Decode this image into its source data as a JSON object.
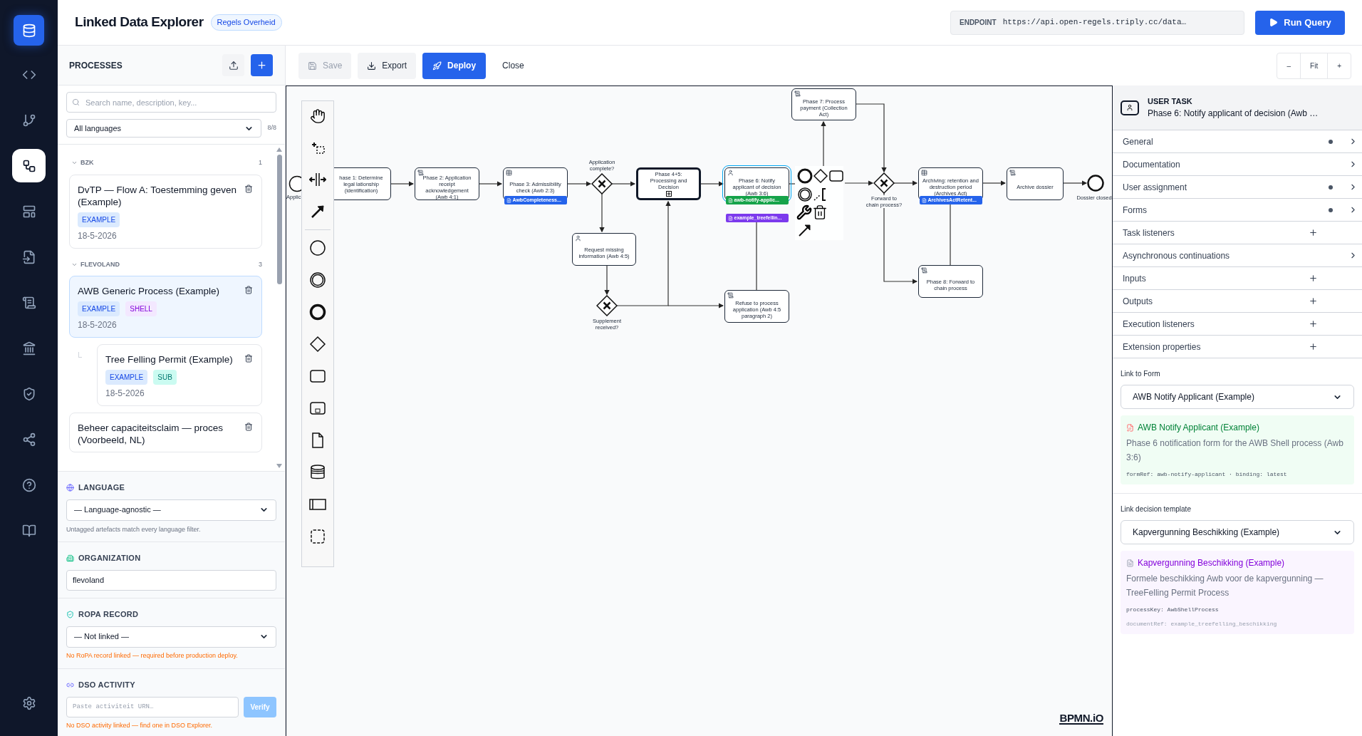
{
  "app": {
    "title": "Linked Data Explorer",
    "badge": "Regels Overheid"
  },
  "nav": [
    {
      "selected": false
    },
    {
      "selected": false
    },
    {
      "selected": true
    },
    {
      "selected": false
    },
    {
      "selected": false
    },
    {
      "selected": false
    },
    {
      "selected": false
    },
    {
      "selected": false
    },
    {
      "selected": false
    },
    {
      "selected": false
    },
    {
      "selected": false
    },
    {
      "selected": false
    }
  ],
  "endpoint": {
    "label": "ENDPOINT",
    "value": "https://api.open-regels.triply.cc/data…"
  },
  "run_query": {
    "label": "Run Query"
  },
  "processes": {
    "title": "PROCESSES",
    "search": {
      "placeholder": "Search name, description, key..."
    },
    "language_filter": "All languages",
    "count": "8/8",
    "groups": [
      {
        "name": "BZK",
        "count": "1",
        "expanded": true,
        "items": [
          {
            "title": "DvTP — Flow A: Toestemming geven (Example)",
            "tags": [
              {
                "label": "EXAMPLE",
                "kind": "example"
              }
            ],
            "date": "18-5-2026",
            "selected": false
          }
        ]
      },
      {
        "name": "FLEVOLAND",
        "count": "3",
        "expanded": true,
        "items": [
          {
            "title": "AWB Generic Process (Example)",
            "tags": [
              {
                "label": "EXAMPLE",
                "kind": "example"
              },
              {
                "label": "SHELL",
                "kind": "shell"
              }
            ],
            "date": "18-5-2026",
            "selected": true,
            "children": [
              {
                "title": "Tree Felling Permit (Example)",
                "tags": [
                  {
                    "label": "EXAMPLE",
                    "kind": "example"
                  },
                  {
                    "label": "SUB",
                    "kind": "sub"
                  }
                ],
                "date": "18-5-2026",
                "selected": false
              }
            ]
          },
          {
            "title": "Beheer capaciteitsclaim — proces (Voorbeeld, NL)",
            "selected": false
          }
        ]
      }
    ]
  },
  "settings": {
    "language": {
      "label": "LANGUAGE",
      "value": "— Language-agnostic —",
      "hint": "Untagged artefacts match every language filter."
    },
    "organization": {
      "label": "ORGANIZATION",
      "value": "flevoland"
    },
    "ropa": {
      "label": "ROPA RECORD",
      "value": "— Not linked —",
      "warning": "No RoPA record linked — required before production deploy."
    },
    "dso": {
      "label": "DSO ACTIVITY",
      "placeholder": "Paste activiteit URN…",
      "button": "Verify",
      "warning": "No DSO activity linked — find one in DSO Explorer."
    }
  },
  "toolbar": {
    "buttons": [
      {
        "label": "Save",
        "kind": "save",
        "disabled": true
      },
      {
        "label": "Export",
        "kind": "export"
      },
      {
        "label": "Deploy",
        "kind": "deploy"
      },
      {
        "label": "Close",
        "kind": "close"
      }
    ],
    "zoom": [
      "–",
      "Fit",
      "+"
    ]
  },
  "diagram": {
    "logo": "BPMN.iO",
    "nodes": [
      {
        "kind": "start",
        "label": "Applic"
      },
      {
        "kind": "task",
        "label": "hase 1: Determine legal lationship (identification)",
        "selected": false
      },
      {
        "kind": "script_task",
        "label": "Phase 2: Application receipt acknowledgement (Awb 4:1)",
        "selected": false
      },
      {
        "kind": "rule_task",
        "label": "Phase 3: Admissibility check (Awb 2:3)",
        "selected": false,
        "tags": [
          {
            "label": "AwbCompleteness...",
            "color": "#2563eb"
          }
        ]
      },
      {
        "kind": "gateway",
        "label": "Application complete?"
      },
      {
        "kind": "subprocess",
        "label": "Phase 4+5: Processing and Decision",
        "selected": false
      },
      {
        "kind": "user_task",
        "label": "Phase 6: Notify applicant of decision (Awb 3:6)",
        "selected": true,
        "tags": [
          {
            "label": "awb-notify-applic...",
            "color": "#16a34a"
          },
          {
            "label": "example_treefellin...",
            "color": "#7c3aed"
          }
        ]
      },
      {
        "kind": "user_task",
        "label": "Request missing information (Awb 4:5)",
        "selected": false
      },
      {
        "kind": "gateway",
        "label": "Supplement received?"
      },
      {
        "kind": "script_task",
        "label": "Refuse to process application (Awb 4:5 paragraph 2)",
        "selected": false
      },
      {
        "kind": "script_task",
        "label": "Phase 7: Process payment (Collection Act)",
        "selected": false
      },
      {
        "kind": "gateway",
        "label": "Forward to chain process?"
      },
      {
        "kind": "rule_task",
        "label": "Archiving: retention and destruction period (Archives Act)",
        "selected": false,
        "tags": [
          {
            "label": "ArchivesActRetent...",
            "color": "#2563eb"
          }
        ]
      },
      {
        "kind": "script_task",
        "label": "Archive dossier",
        "selected": false
      },
      {
        "kind": "end",
        "label": "Dossier closed"
      },
      {
        "kind": "script_task",
        "label": "Phase 8: Forward to chain process",
        "selected": false
      }
    ]
  },
  "properties": {
    "type_label": "USER TASK",
    "name": "Phase 6: Notify applicant of decision (Awb …",
    "groups": [
      {
        "label": "General",
        "has_data": true,
        "kind": "expand"
      },
      {
        "label": "Documentation",
        "has_data": false,
        "kind": "expand"
      },
      {
        "label": "User assignment",
        "has_data": true,
        "kind": "expand"
      },
      {
        "label": "Forms",
        "has_data": true,
        "kind": "expand"
      },
      {
        "label": "Task listeners",
        "has_data": false,
        "kind": "add"
      },
      {
        "label": "Asynchronous continuations",
        "has_data": false,
        "kind": "expand"
      },
      {
        "label": "Inputs",
        "has_data": false,
        "kind": "add"
      },
      {
        "label": "Outputs",
        "has_data": false,
        "kind": "add"
      },
      {
        "label": "Execution listeners",
        "has_data": false,
        "kind": "add"
      },
      {
        "label": "Extension properties",
        "has_data": false,
        "kind": "add"
      }
    ],
    "links": [
      {
        "kind": "form",
        "label": "Link to Form",
        "value": "AWB Notify Applicant (Example)",
        "card": {
          "title": "AWB Notify Applicant (Example)",
          "description": "Phase 6 notification form for the AWB Shell process (Awb 3:6)",
          "meta": [
            "formRef: awb-notify-applicant · binding: latest"
          ]
        }
      },
      {
        "kind": "decision",
        "label": "Link decision template",
        "value": "Kapvergunning Beschikking (Example)",
        "card": {
          "title": "Kapvergunning Beschikking (Example)",
          "description": "Formele beschikking Awb voor de kapvergunning — TreeFelling Permit Process",
          "meta": [
            "processKey: AwbShellProcess",
            "documentRef: example_treefelling_beschikking"
          ]
        }
      }
    ]
  }
}
